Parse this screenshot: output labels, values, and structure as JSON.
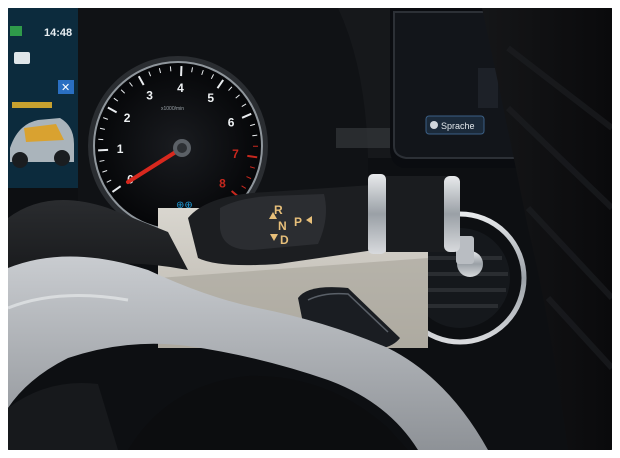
{
  "instrument_cluster": {
    "clock": "14:48",
    "tach_ticks": [
      "1",
      "2",
      "3",
      "4",
      "5",
      "6",
      "7",
      "8"
    ],
    "tach_zero": "0",
    "tach_brand": "x1000/min",
    "needle_color": "#d8281e",
    "redline_color": "#c8281e"
  },
  "gear_selector": {
    "positions": {
      "reverse": "R",
      "neutral": "N",
      "park": "P",
      "drive": "D"
    },
    "active_color": "#e7bf7a"
  },
  "media_display": {
    "button_label": "Sprache"
  }
}
